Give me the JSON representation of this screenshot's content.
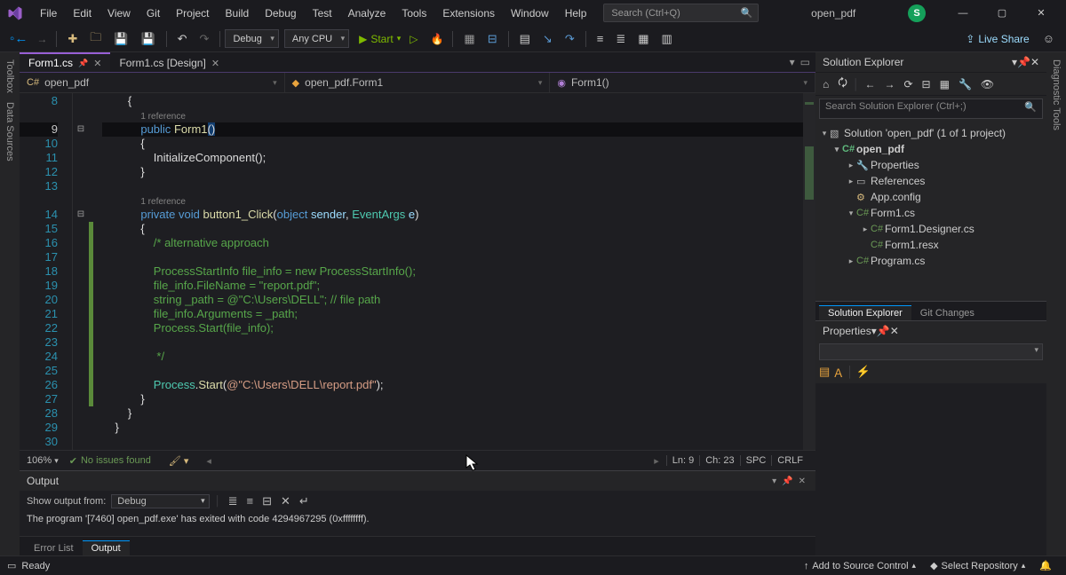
{
  "menu": [
    "File",
    "Edit",
    "View",
    "Git",
    "Project",
    "Build",
    "Debug",
    "Test",
    "Analyze",
    "Tools",
    "Extensions",
    "Window",
    "Help"
  ],
  "title_search_placeholder": "Search (Ctrl+Q)",
  "title_solution": "open_pdf",
  "avatar_initial": "S",
  "toolbar": {
    "config": "Debug",
    "platform": "Any CPU",
    "start_label": "Start"
  },
  "live_share": "Live Share",
  "left_rails": [
    "Toolbox",
    "Data Sources"
  ],
  "right_rail": "Diagnostic Tools",
  "doc_tabs": [
    {
      "label": "Form1.cs",
      "active": true,
      "pinned": true
    },
    {
      "label": "Form1.cs [Design]",
      "active": false,
      "pinned": false
    }
  ],
  "nav": {
    "project": "open_pdf",
    "class": "open_pdf.Form1",
    "member": "Form1()"
  },
  "gutter_start": 8,
  "code": {
    "lines": [
      {
        "n": 8,
        "ind": 2,
        "txt": "{"
      },
      {
        "n": "",
        "ind": 3,
        "ref": "1 reference"
      },
      {
        "n": 9,
        "ind": 3,
        "kw": "public",
        "mth": "Form1",
        "paren": "()",
        "cur": true,
        "hl": true
      },
      {
        "n": 10,
        "ind": 3,
        "txt": "{"
      },
      {
        "n": 11,
        "ind": 4,
        "call": "InitializeComponent();"
      },
      {
        "n": 12,
        "ind": 3,
        "txt": "}"
      },
      {
        "n": 13,
        "ind": 0,
        "txt": ""
      },
      {
        "n": "",
        "ind": 3,
        "ref": "1 reference"
      },
      {
        "n": 14,
        "ind": 3,
        "sig": true
      },
      {
        "n": 15,
        "ind": 3,
        "txt": "{",
        "g": true
      },
      {
        "n": 16,
        "ind": 4,
        "cmt": "/* alternative approach",
        "g": true
      },
      {
        "n": 17,
        "ind": 0,
        "txt": "",
        "g": true
      },
      {
        "n": 18,
        "ind": 4,
        "cmt": "ProcessStartInfo file_info = new ProcessStartInfo();",
        "g": true
      },
      {
        "n": 19,
        "ind": 4,
        "cmt": "file_info.FileName = \"report.pdf\";",
        "g": true
      },
      {
        "n": 20,
        "ind": 4,
        "cmt": "string _path = @\"C:\\Users\\DELL\"; // file path",
        "g": true
      },
      {
        "n": 21,
        "ind": 4,
        "cmt": "file_info.Arguments = _path;",
        "g": true
      },
      {
        "n": 22,
        "ind": 4,
        "cmt": "Process.Start(file_info);",
        "g": true
      },
      {
        "n": 23,
        "ind": 0,
        "txt": "",
        "g": true
      },
      {
        "n": 24,
        "ind": 4,
        "cmt": " */",
        "g": true
      },
      {
        "n": 25,
        "ind": 0,
        "txt": "",
        "g": true
      },
      {
        "n": 26,
        "ind": 4,
        "pstart": true,
        "g": true
      },
      {
        "n": 27,
        "ind": 3,
        "txt": "}",
        "g": true
      },
      {
        "n": 28,
        "ind": 2,
        "txt": "}"
      },
      {
        "n": 29,
        "ind": 1,
        "txt": "}"
      },
      {
        "n": 30,
        "ind": 0,
        "txt": ""
      }
    ],
    "sig_parts": {
      "kw1": "private",
      "kw2": "void",
      "mth": "button1_Click",
      "p1t": "object",
      "p1n": "sender",
      "p2t": "EventArgs",
      "p2n": "e"
    },
    "pstart_parts": {
      "cls": "Process",
      "mth": "Start",
      "str": "@\"C:\\Users\\DELL\\report.pdf\""
    }
  },
  "editor_status": {
    "zoom": "106%",
    "issues": "No issues found",
    "ln": "Ln: 9",
    "ch": "Ch: 23",
    "spc": "SPC",
    "crlf": "CRLF"
  },
  "output": {
    "title": "Output",
    "from_label": "Show output from:",
    "from_value": "Debug",
    "line": "The program '[7460] open_pdf.exe' has exited with code 4294967295 (0xffffffff)."
  },
  "bottom_tabs": [
    "Error List",
    "Output"
  ],
  "solution_explorer": {
    "title": "Solution Explorer",
    "search_placeholder": "Search Solution Explorer (Ctrl+;)",
    "tree": [
      {
        "d": 0,
        "tw": "▾",
        "ic": "sol",
        "label": "Solution 'open_pdf' (1 of 1 project)"
      },
      {
        "d": 1,
        "tw": "▾",
        "ic": "csproj",
        "label": "open_pdf",
        "bold": true
      },
      {
        "d": 2,
        "tw": "▸",
        "ic": "wrench",
        "label": "Properties"
      },
      {
        "d": 2,
        "tw": "▸",
        "ic": "ref",
        "label": "References"
      },
      {
        "d": 2,
        "tw": "",
        "ic": "cfg",
        "label": "App.config"
      },
      {
        "d": 2,
        "tw": "▾",
        "ic": "cs",
        "label": "Form1.cs"
      },
      {
        "d": 3,
        "tw": "▸",
        "ic": "cs",
        "label": "Form1.Designer.cs"
      },
      {
        "d": 3,
        "tw": "",
        "ic": "cs",
        "label": "Form1.resx"
      },
      {
        "d": 2,
        "tw": "▸",
        "ic": "cs",
        "label": "Program.cs"
      }
    ],
    "tabs": [
      "Solution Explorer",
      "Git Changes"
    ]
  },
  "properties": {
    "title": "Properties"
  },
  "status": {
    "ready": "Ready",
    "source_control": "Add to Source Control",
    "repo": "Select Repository"
  }
}
